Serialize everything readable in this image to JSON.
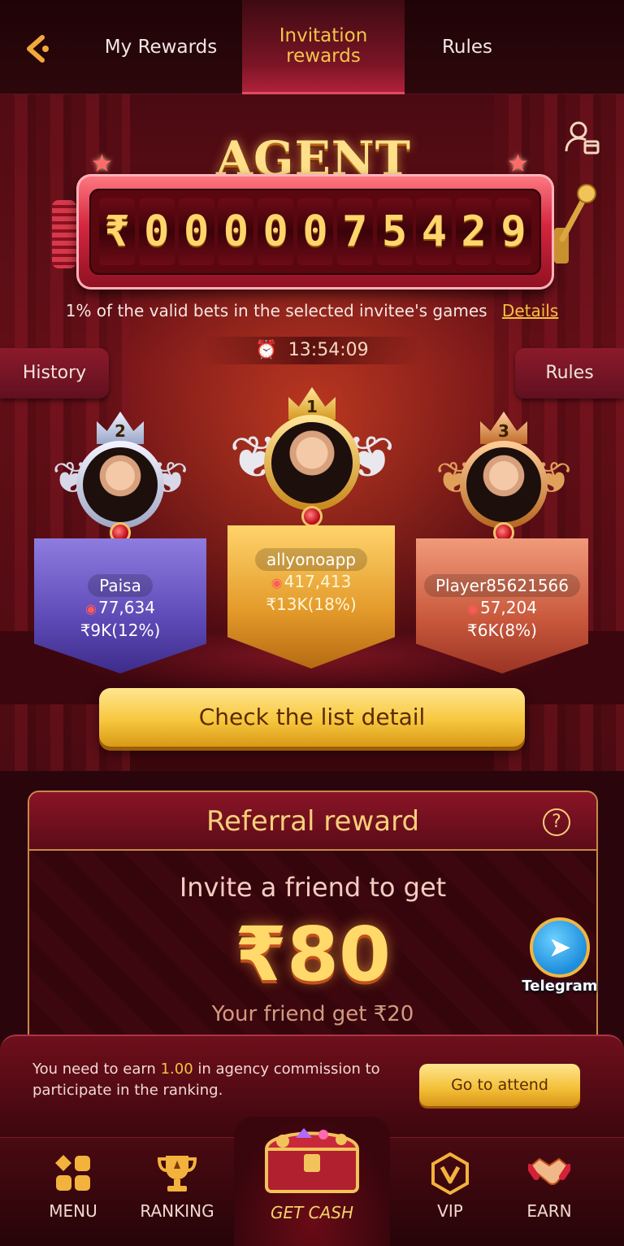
{
  "tabs": {
    "my_rewards": "My Rewards",
    "invitation_rewards_line1": "Invitation",
    "invitation_rewards_line2": "rewards",
    "rules": "Rules"
  },
  "jackpot": {
    "title": "AGENT JACKPOT",
    "currency": "₹",
    "digits": [
      "0",
      "0",
      "0",
      "0",
      "0",
      "7",
      "5",
      "4",
      "2",
      "9"
    ],
    "info": "1% of the valid bets in the selected invitee's games",
    "details_link": "Details",
    "timer": "13:54:09"
  },
  "side_buttons": {
    "history": "History",
    "rules": "Rules"
  },
  "leaderboard": [
    {
      "rank": "2",
      "name": "Paisa",
      "score": "77,634",
      "amount": "₹9K(12%)"
    },
    {
      "rank": "1",
      "name": "allyonoapp",
      "score": "417,413",
      "amount": "₹13K(18%)"
    },
    {
      "rank": "3",
      "name": "Player85621566",
      "score": "57,204",
      "amount": "₹6K(8%)"
    }
  ],
  "check_button": "Check the list detail",
  "referral": {
    "title": "Referral reward",
    "subtitle": "Invite a friend to get",
    "amount": "₹80",
    "friend_text": "Your friend get ₹20"
  },
  "telegram_label": "Telegram",
  "notice": {
    "text_before": "You need to earn ",
    "value": "1.00",
    "text_after": " in agency commission to participate in the ranking.",
    "button": "Go to attend"
  },
  "nav": {
    "menu": "MENU",
    "ranking": "RANKING",
    "get_cash": "GET CASH",
    "vip": "VIP",
    "earn": "EARN"
  },
  "colors": {
    "accent_gold": "#f4c240",
    "background": "#2a060c",
    "tab_active": "#f3c54a"
  }
}
